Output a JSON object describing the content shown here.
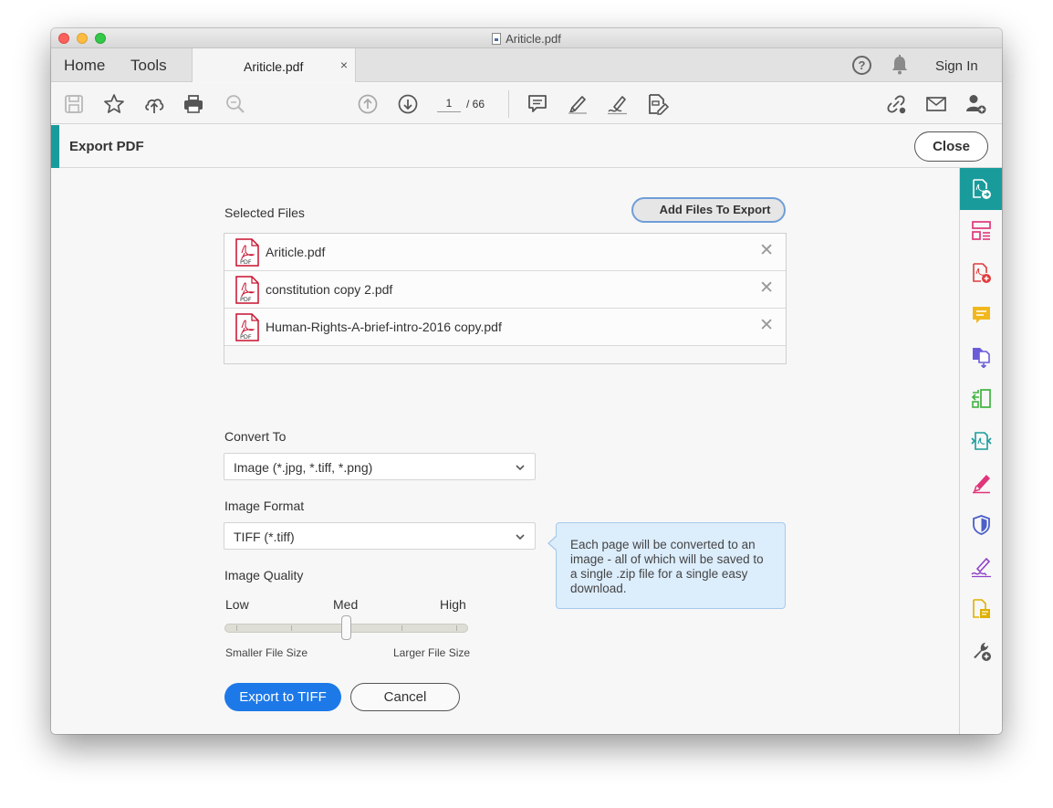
{
  "window": {
    "title": "Ariticle.pdf"
  },
  "tabs": {
    "home": "Home",
    "tools": "Tools",
    "document": "Ariticle.pdf",
    "close_glyph": "×"
  },
  "topbar": {
    "help_glyph": "?",
    "sign_in": "Sign In"
  },
  "toolbar": {
    "current_page": "1",
    "page_total": "/ 66"
  },
  "header": {
    "title": "Export PDF",
    "close": "Close"
  },
  "files": {
    "label": "Selected Files",
    "add_button": "Add Files To Export",
    "pdf_badge": "PDF",
    "remove_glyph": "✕",
    "items": [
      {
        "name": "Ariticle.pdf"
      },
      {
        "name": "constitution copy 2.pdf"
      },
      {
        "name": "Human-Rights-A-brief-intro-2016 copy.pdf"
      }
    ]
  },
  "convert": {
    "label": "Convert To",
    "value": "Image (*.jpg, *.tiff, *.png)"
  },
  "image_format": {
    "label": "Image Format",
    "value": "TIFF (*.tiff)",
    "tooltip": "Each page will be converted to an image - all of which will be saved to a single .zip file for a single easy download."
  },
  "quality": {
    "label": "Image Quality",
    "low": "Low",
    "med": "Med",
    "high": "High",
    "smaller": "Smaller File Size",
    "larger": "Larger File Size",
    "level": 0.5
  },
  "actions": {
    "export": "Export to TIFF",
    "cancel": "Cancel"
  },
  "colors": {
    "accent_teal": "#1a9b9b",
    "primary_blue": "#1d79e8",
    "tooltip_bg": "#dcedfc",
    "pdf_red": "#c8102e"
  },
  "rail_icons": [
    "export-pdf-icon",
    "organize-pages-icon",
    "create-pdf-icon",
    "comment-icon",
    "combine-files-icon",
    "compare-icon",
    "edit-pdf-icon",
    "fill-sign-icon",
    "protect-icon",
    "send-for-signature-icon",
    "scan-icon",
    "more-tools-icon"
  ]
}
